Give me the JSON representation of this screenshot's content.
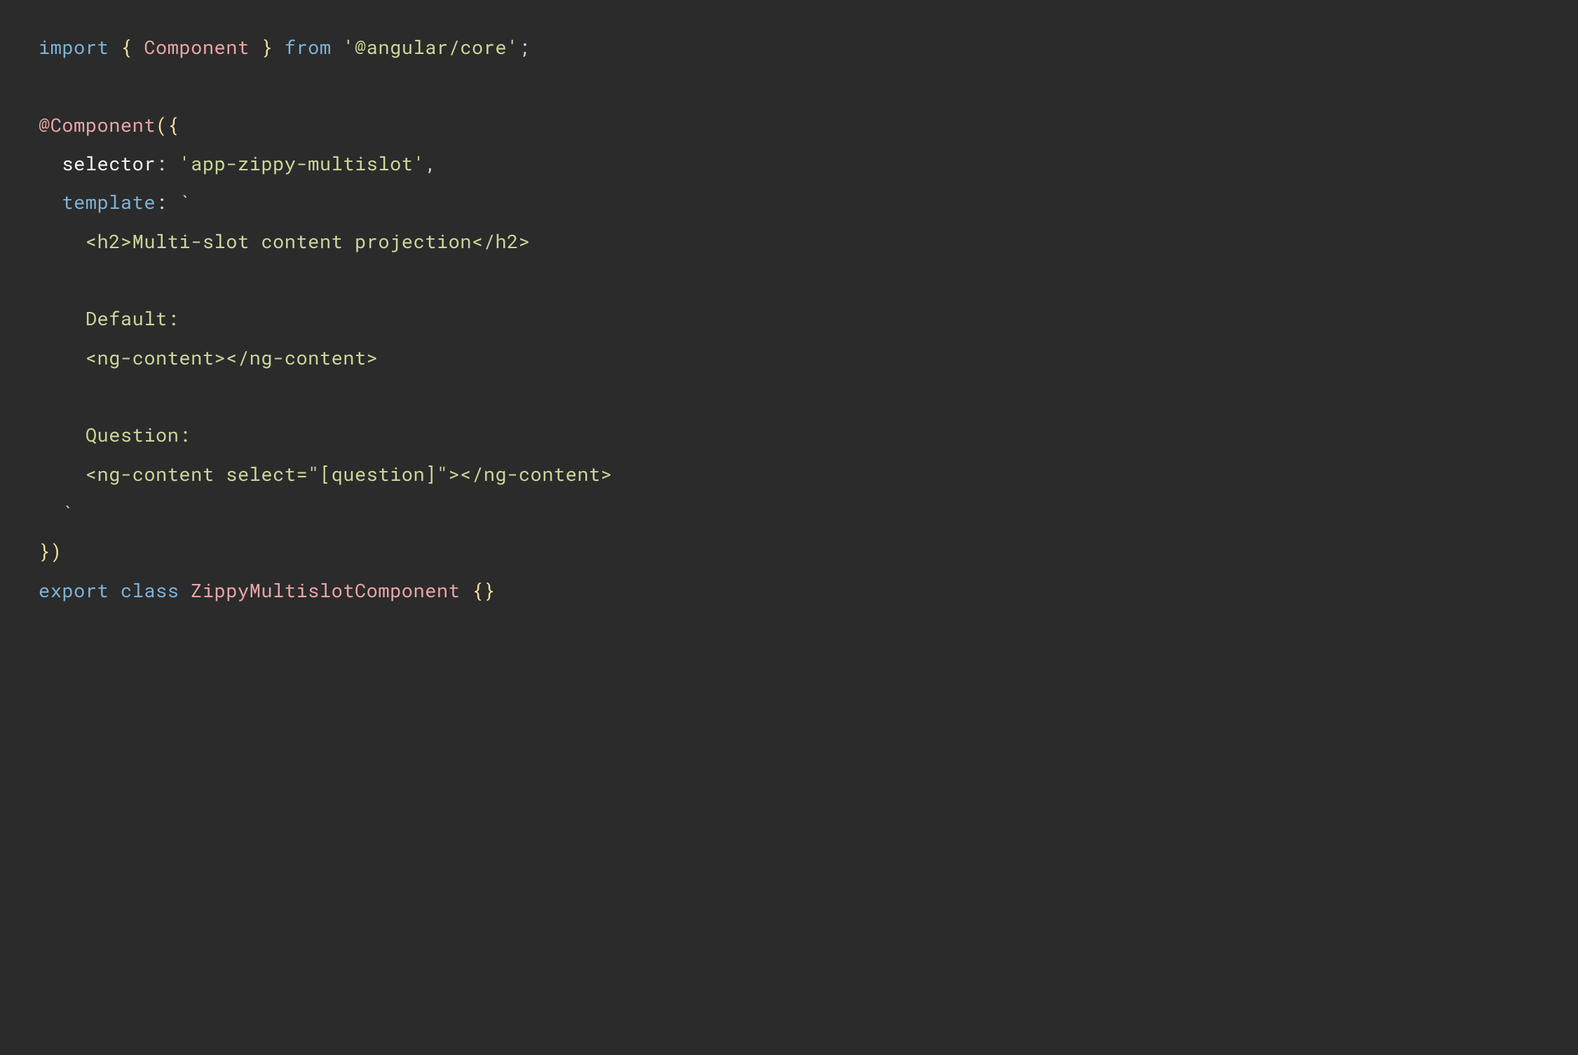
{
  "code": {
    "line1": {
      "import": "import",
      "openBrace": " { ",
      "component": "Component",
      "closeBrace": " } ",
      "from": "from",
      "space": " ",
      "string": "'@angular/core'",
      "semi": ";"
    },
    "line2": "",
    "line3": {
      "decorator": "@Component",
      "open": "({"
    },
    "line4": {
      "indent": "  ",
      "prop": "selector",
      "colon": ": ",
      "value": "'app-zippy-multislot'",
      "comma": ","
    },
    "line5": {
      "indent": "  ",
      "prop": "template",
      "colon": ": ",
      "backtick": "`"
    },
    "line6": {
      "indent": "    ",
      "content": "<h2>Multi-slot content projection</h2>"
    },
    "line7": "",
    "line8": {
      "indent": "    ",
      "content": "Default:"
    },
    "line9": {
      "indent": "    ",
      "content": "<ng-content></ng-content>"
    },
    "line10": "",
    "line11": {
      "indent": "    ",
      "content": "Question:"
    },
    "line12": {
      "indent": "    ",
      "content": "<ng-content select=\"[question]\"></ng-content>"
    },
    "line13": {
      "indent": "  ",
      "backtick": "`"
    },
    "line14": {
      "close": "})"
    },
    "line15": {
      "export": "export",
      "space1": " ",
      "class": "class",
      "space2": " ",
      "classname": "ZippyMultislotComponent",
      "space3": " ",
      "braces": "{}"
    }
  }
}
